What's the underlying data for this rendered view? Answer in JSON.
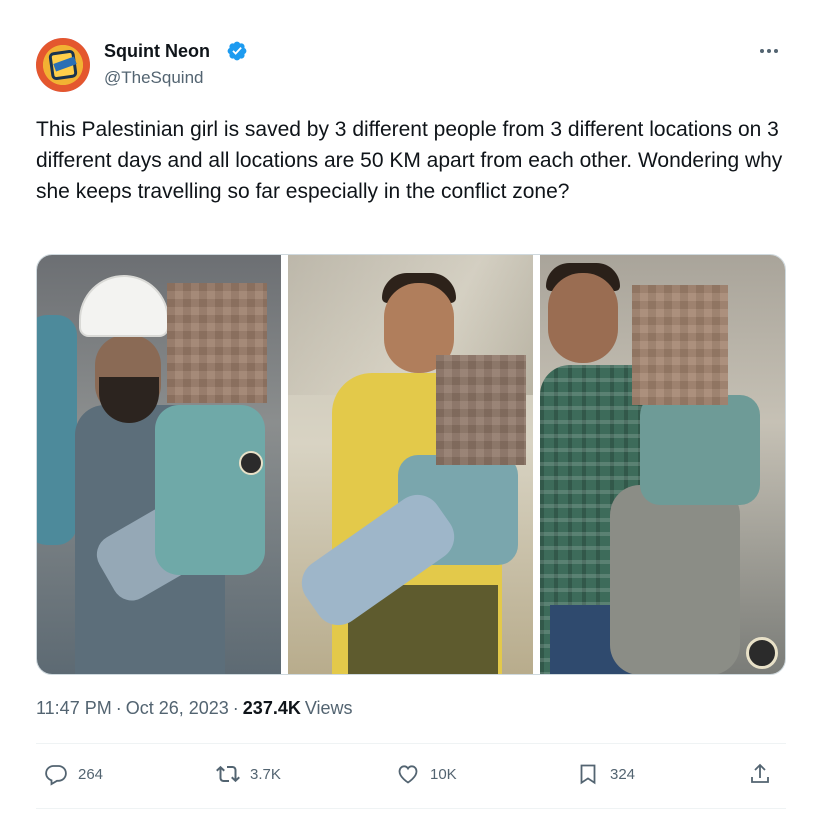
{
  "author": {
    "display_name": "Squint Neon",
    "handle": "@TheSquind",
    "verified": true
  },
  "tweet": {
    "text": "This Palestinian girl is saved by 3 different people from 3 different locations on 3 different days and all locations are 50 KM apart from each other. Wondering why she keeps travelling so far especially in the conflict zone?"
  },
  "media": {
    "panel_count": 3
  },
  "meta": {
    "time": "11:47 PM",
    "separator": "·",
    "date": "Oct 26, 2023",
    "views_count": "237.4K",
    "views_label": "Views"
  },
  "actions": {
    "reply_count": "264",
    "retweet_count": "3.7K",
    "like_count": "10K",
    "bookmark_count": "324"
  },
  "colors": {
    "text_primary": "#0f1419",
    "text_secondary": "#536471",
    "verified_blue": "#1d9bf0",
    "divider": "#eff3f4"
  }
}
